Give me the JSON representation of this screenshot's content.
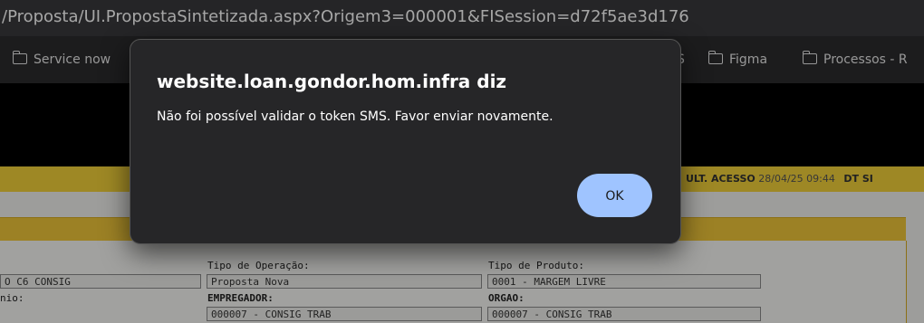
{
  "browser": {
    "url": "/Proposta/UI.PropostaSintetizada.aspx?Origem3=000001&FISession=d72f5ae3d176"
  },
  "bookmarks": {
    "items": [
      {
        "label": "Service now",
        "icon": "folder-icon"
      },
      {
        "label": "S",
        "icon": null
      },
      {
        "label": "Figma",
        "icon": "folder-icon"
      },
      {
        "label": "Processos - R",
        "icon": "folder-icon"
      }
    ]
  },
  "status_bar": {
    "last_access_label": "ULT. ACESSO",
    "last_access_value": "28/04/25 09:44",
    "dt_label": "DT SI"
  },
  "form": {
    "left_value_1": "O C6 CONSIG",
    "left_label_2": "nio:",
    "tipo_operacao_label": "Tipo de Operação:",
    "tipo_operacao_value": "Proposta Nova",
    "tipo_produto_label": "Tipo de Produto:",
    "tipo_produto_value": "0001 - MARGEM LIVRE",
    "empregador_label": "EMPREGADOR:",
    "empregador_value": "000007 - CONSIG TRAB",
    "orgao_label": "ORGAO:",
    "orgao_value": "000007 - CONSIG TRAB"
  },
  "dialog": {
    "title": "website.loan.gondor.hom.infra diz",
    "message": "Não foi possível validar o token SMS. Favor enviar novamente.",
    "ok_label": "OK"
  },
  "colors": {
    "accent_button": "#9fc4ff",
    "status_bar": "#f3d13a",
    "dialog_bg": "#262628"
  }
}
